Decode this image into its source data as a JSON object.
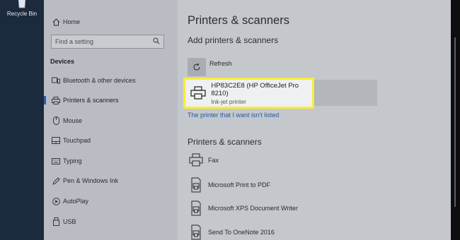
{
  "desktop": {
    "recycle_bin_label": "Recycle Bin"
  },
  "sidebar": {
    "home_label": "Home",
    "search_placeholder": "Find a setting",
    "section_label": "Devices",
    "items": [
      {
        "label": "Bluetooth & other devices",
        "icon": "bluetooth-devices-icon",
        "active": false
      },
      {
        "label": "Printers & scanners",
        "icon": "printer-icon",
        "active": true
      },
      {
        "label": "Mouse",
        "icon": "mouse-icon",
        "active": false
      },
      {
        "label": "Touchpad",
        "icon": "touchpad-icon",
        "active": false
      },
      {
        "label": "Typing",
        "icon": "keyboard-icon",
        "active": false
      },
      {
        "label": "Pen & Windows Ink",
        "icon": "pen-icon",
        "active": false
      },
      {
        "label": "AutoPlay",
        "icon": "autoplay-icon",
        "active": false
      },
      {
        "label": "USB",
        "icon": "usb-icon",
        "active": false
      }
    ]
  },
  "main": {
    "title": "Printers & scanners",
    "add_heading": "Add printers & scanners",
    "refresh_label": "Refresh",
    "found_printer": {
      "name": "HP83C2E8 (HP OfficeJet Pro 8210)",
      "type": "Ink-jet printer"
    },
    "not_listed_link": "The printer that I want isn't listed",
    "list_heading": "Printers & scanners",
    "devices": [
      {
        "label": "Fax",
        "icon": "fax-icon"
      },
      {
        "label": "Microsoft Print to PDF",
        "icon": "printer-document-icon"
      },
      {
        "label": "Microsoft XPS Document Writer",
        "icon": "printer-document-icon"
      },
      {
        "label": "Send To OneNote 2016",
        "icon": "printer-document-icon"
      }
    ]
  },
  "colors": {
    "accent": "#2b5ea8",
    "link": "#1f5aa0",
    "highlight": "#f6ee3a"
  }
}
